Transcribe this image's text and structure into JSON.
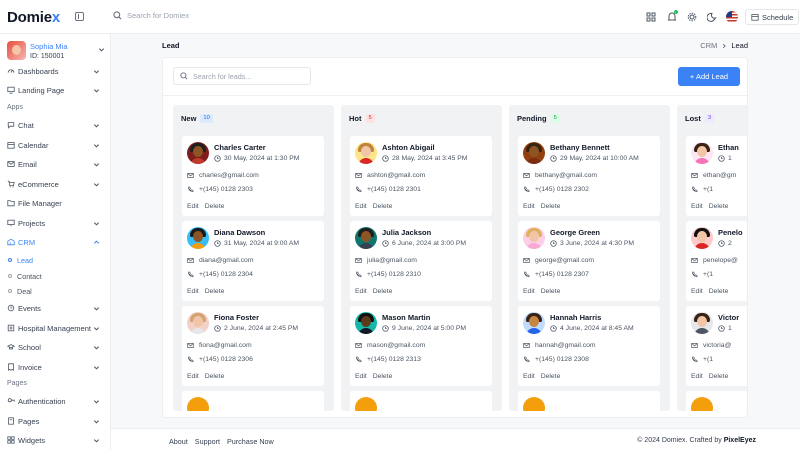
{
  "app": {
    "logo_main": "Domie",
    "logo_accent": "x"
  },
  "header": {
    "search_placeholder": "Search for Domiex",
    "schedule_label": "Schedule"
  },
  "user": {
    "name": "Sophia Mia",
    "id": "ID: 150001"
  },
  "sidebar": {
    "top_items": [
      {
        "label": "Dashboards",
        "icon": "gauge-icon"
      },
      {
        "label": "Landing Page",
        "icon": "monitor-icon"
      }
    ],
    "section_apps": "Apps",
    "apps": [
      {
        "label": "Chat",
        "icon": "chat-icon"
      },
      {
        "label": "Calendar",
        "icon": "calendar-icon"
      },
      {
        "label": "Email",
        "icon": "mail-icon"
      },
      {
        "label": "eCommerce",
        "icon": "cart-icon"
      },
      {
        "label": "File Manager",
        "icon": "folder-icon"
      },
      {
        "label": "Projects",
        "icon": "projects-icon"
      },
      {
        "label": "CRM",
        "icon": "crm-icon"
      }
    ],
    "crm_sub": [
      {
        "label": "Lead"
      },
      {
        "label": "Contact"
      },
      {
        "label": "Deal"
      }
    ],
    "more": [
      {
        "label": "Events",
        "icon": "events-icon"
      },
      {
        "label": "Hospital Management",
        "icon": "hospital-icon"
      },
      {
        "label": "School",
        "icon": "school-icon"
      },
      {
        "label": "Invoice",
        "icon": "invoice-icon"
      }
    ],
    "section_pages": "Pages",
    "pages": [
      {
        "label": "Authentication",
        "icon": "auth-icon"
      },
      {
        "label": "Pages",
        "icon": "pages-icon"
      },
      {
        "label": "Widgets",
        "icon": "widgets-icon"
      }
    ]
  },
  "page": {
    "title": "Lead",
    "breadcrumb": [
      "CRM",
      "Lead"
    ],
    "search_placeholder": "Search for leads...",
    "add_button": "+ Add Lead"
  },
  "columns": [
    {
      "title": "New",
      "count": "10",
      "badge_bg": "#dbeafe",
      "badge_fg": "#2563eb",
      "cards": [
        {
          "name": "Charles Carter",
          "date": "30 May, 2024 at 1:30 PM",
          "email": "charles@gmail.com",
          "phone": "+(145) 0128 2303",
          "skin": "#8d5524",
          "hair": "#1f1f1f",
          "shirt": "#c0392b",
          "bg": "#7f1d1d"
        },
        {
          "name": "Diana Dawson",
          "date": "31 May, 2024 at 9:00 AM",
          "email": "diana@gmail.com",
          "phone": "+(145) 0128 2304",
          "skin": "#8d5524",
          "hair": "#1a1a1a",
          "shirt": "#f59e0b",
          "bg": "#38bdf8"
        },
        {
          "name": "Fiona Foster",
          "date": "2 June, 2024 at 2:45 PM",
          "email": "fiona@gmail.com",
          "phone": "+(145) 0128 2306",
          "skin": "#f1c6a8",
          "hair": "#d4a373",
          "shirt": "#e5e7eb",
          "bg": "#f3d1c8"
        }
      ]
    },
    {
      "title": "Hot",
      "count": "5",
      "badge_bg": "#fee2e2",
      "badge_fg": "#dc2626",
      "cards": [
        {
          "name": "Ashton Abigail",
          "date": "28 May, 2024 at 3:45 PM",
          "email": "ashton@gmail.com",
          "phone": "+(145) 0128 2301",
          "skin": "#f1c6a8",
          "hair": "#c0843b",
          "shirt": "#dc2626",
          "bg": "#fde68a"
        },
        {
          "name": "Julia Jackson",
          "date": "6 June, 2024 at 3:00 PM",
          "email": "julia@gmail.com",
          "phone": "+(145) 0128 2310",
          "skin": "#8d5524",
          "hair": "#1f1f1f",
          "shirt": "#374151",
          "bg": "#0f766e"
        },
        {
          "name": "Mason Martin",
          "date": "9 June, 2024 at 5:00 PM",
          "email": "mason@gmail.com",
          "phone": "+(145) 0128 2313",
          "skin": "#5b3a1e",
          "hair": "#111111",
          "shirt": "#111827",
          "bg": "#14b8a6"
        }
      ]
    },
    {
      "title": "Pending",
      "count": "5",
      "badge_bg": "#dcfce7",
      "badge_fg": "#16a34a",
      "cards": [
        {
          "name": "Bethany Bennett",
          "date": "29 May, 2024 at 10:00 AM",
          "email": "bethany@gmail.com",
          "phone": "+(145) 0128 2302",
          "skin": "#8d5524",
          "hair": "#3b2314",
          "shirt": "#7c2d12",
          "bg": "#92400e"
        },
        {
          "name": "George Green",
          "date": "3 June, 2024 at 4:30 PM",
          "email": "george@gmail.com",
          "phone": "+(145) 0128 2307",
          "skin": "#f1c6a8",
          "hair": "#e0b060",
          "shirt": "#f9a8d4",
          "bg": "#fbcfe8"
        },
        {
          "name": "Hannah Harris",
          "date": "4 June, 2024 at 8:45 AM",
          "email": "hannah@gmail.com",
          "phone": "+(145) 0128 2308",
          "skin": "#c68642",
          "hair": "#3b2314",
          "shirt": "#2563eb",
          "bg": "#bfdbfe"
        }
      ]
    },
    {
      "title": "Lost",
      "count": "3",
      "badge_bg": "#ede9fe",
      "badge_fg": "#7c3aed",
      "cards": [
        {
          "name": "Ethan",
          "date": "1",
          "email": "ethan@gm",
          "phone": "+(1",
          "skin": "#f1c6a8",
          "hair": "#3b2314",
          "shirt": "#f472b6",
          "bg": "#fce7f3"
        },
        {
          "name": "Penelo",
          "date": "2",
          "email": "penelope@",
          "phone": "+(1",
          "skin": "#f1c6a8",
          "hair": "#111111",
          "shirt": "#dc2626",
          "bg": "#fecaca"
        },
        {
          "name": "Victor",
          "date": "1",
          "email": "victoria@",
          "phone": "+(1",
          "skin": "#f1c6a8",
          "hair": "#3b2314",
          "shirt": "#4b5563",
          "bg": "#e5e7eb"
        }
      ]
    }
  ],
  "card_actions": {
    "edit": "Edit",
    "delete": "Delete"
  },
  "footer": {
    "links": [
      "About",
      "Support",
      "Purchase Now"
    ],
    "copyright_prefix": "© 2024 Domiex. Crafted by ",
    "brand": "PixelEyez"
  }
}
